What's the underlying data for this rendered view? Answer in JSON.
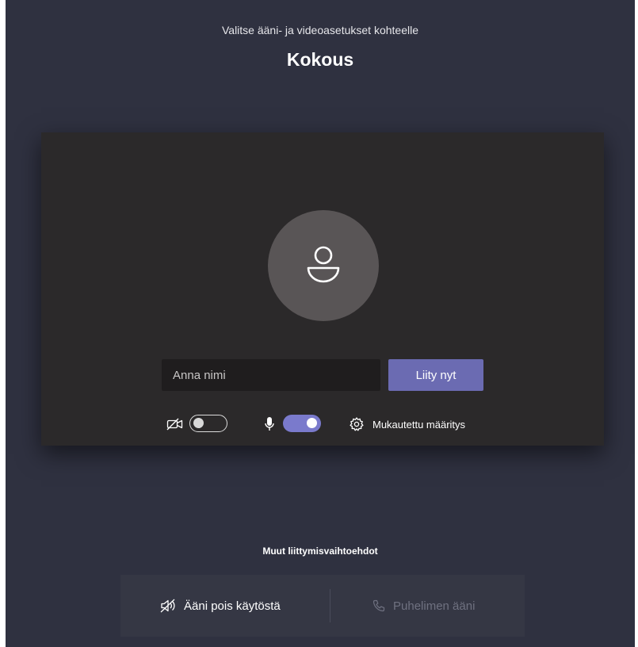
{
  "header": {
    "subtitle": "Valitse ääni- ja videoasetukset kohteelle",
    "meeting_title": "Kokous"
  },
  "prejoin": {
    "avatar_icon": "person-icon",
    "name_input": {
      "value": "",
      "placeholder": "Anna nimi"
    },
    "join_button_label": "Liity nyt",
    "camera": {
      "icon": "camera-off-icon",
      "enabled": false
    },
    "microphone": {
      "icon": "microphone-icon",
      "enabled": true
    },
    "device_settings_label": "Mukautettu määritys"
  },
  "other_options": {
    "title": "Muut liittymisvaihtoehdot",
    "audio_off_label": "Ääni pois käytöstä",
    "phone_audio_label": "Puhelimen ääni"
  },
  "colors": {
    "background": "#2f3140",
    "panel": "#2b292a",
    "accent": "#6b6bb2",
    "toggle_on": "#7a7acc"
  }
}
